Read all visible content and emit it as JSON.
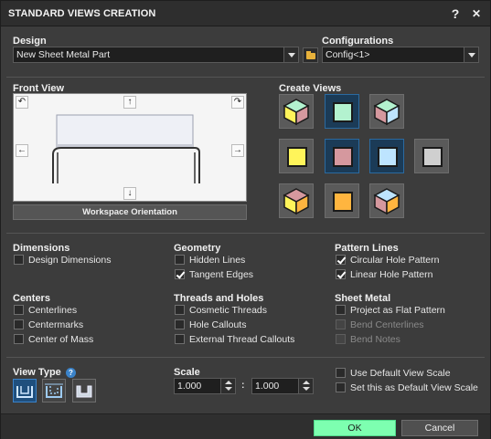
{
  "window": {
    "title": "STANDARD VIEWS CREATION",
    "help_glyph": "?",
    "close_glyph": "✕"
  },
  "design": {
    "label": "Design",
    "value": "New Sheet Metal Part"
  },
  "configurations": {
    "label": "Configurations",
    "value": "Config<1>"
  },
  "front_view": {
    "label": "Front View",
    "orientation_button": "Workspace Orientation",
    "arrows": {
      "up": "↑",
      "down": "↓",
      "left": "←",
      "right": "→",
      "rot_left": "↶",
      "rot_right": "↷"
    }
  },
  "create_views": {
    "label": "Create Views",
    "buttons": [
      {
        "name": "isometric-1",
        "kind": "iso"
      },
      {
        "name": "top",
        "kind": "square",
        "color": "#b3f2cf",
        "selected": true
      },
      {
        "name": "isometric-2",
        "kind": "iso"
      },
      {
        "name": "left",
        "kind": "square",
        "color": "#fff45a",
        "selected": false
      },
      {
        "name": "front",
        "kind": "square",
        "color": "#d5989e",
        "selected": true
      },
      {
        "name": "right",
        "kind": "square",
        "color": "#bde4ff",
        "selected": true
      },
      {
        "name": "back",
        "kind": "square",
        "color": "#cfcfcf",
        "selected": false
      },
      {
        "name": "isometric-3",
        "kind": "iso"
      },
      {
        "name": "bottom",
        "kind": "square",
        "color": "#ffb53f",
        "selected": false
      },
      {
        "name": "isometric-4",
        "kind": "iso"
      }
    ]
  },
  "dimensions": {
    "label": "Dimensions",
    "items": [
      {
        "label": "Design Dimensions",
        "checked": false
      }
    ]
  },
  "geometry": {
    "label": "Geometry",
    "items": [
      {
        "label": "Hidden Lines",
        "checked": false
      },
      {
        "label": "Tangent Edges",
        "checked": true
      }
    ]
  },
  "pattern_lines": {
    "label": "Pattern Lines",
    "items": [
      {
        "label": "Circular Hole Pattern",
        "checked": true
      },
      {
        "label": "Linear Hole Pattern",
        "checked": true
      }
    ]
  },
  "centers": {
    "label": "Centers",
    "items": [
      {
        "label": "Centerlines",
        "checked": false
      },
      {
        "label": "Centermarks",
        "checked": false
      },
      {
        "label": "Center of Mass",
        "checked": false
      }
    ]
  },
  "threads": {
    "label": "Threads and Holes",
    "items": [
      {
        "label": "Cosmetic Threads",
        "checked": false
      },
      {
        "label": "Hole Callouts",
        "checked": false
      },
      {
        "label": "External Thread Callouts",
        "checked": false
      }
    ]
  },
  "sheet_metal": {
    "label": "Sheet Metal",
    "items": [
      {
        "label": "Project as Flat Pattern",
        "checked": false,
        "disabled": false
      },
      {
        "label": "Bend Centerlines",
        "checked": false,
        "disabled": true
      },
      {
        "label": "Bend Notes",
        "checked": false,
        "disabled": true
      }
    ]
  },
  "view_type": {
    "label": "View Type",
    "info_glyph": "?"
  },
  "scale": {
    "label": "Scale",
    "left": "1.000",
    "sep": ":",
    "right": "1.000"
  },
  "scale_options": [
    {
      "label": "Use Default View Scale",
      "checked": false
    },
    {
      "label": "Set this as Default View Scale",
      "checked": false
    }
  ],
  "footer": {
    "ok": "OK",
    "cancel": "Cancel"
  },
  "colors": {
    "ok_bg": "#7dffb0",
    "accent": "#3b83c9"
  }
}
